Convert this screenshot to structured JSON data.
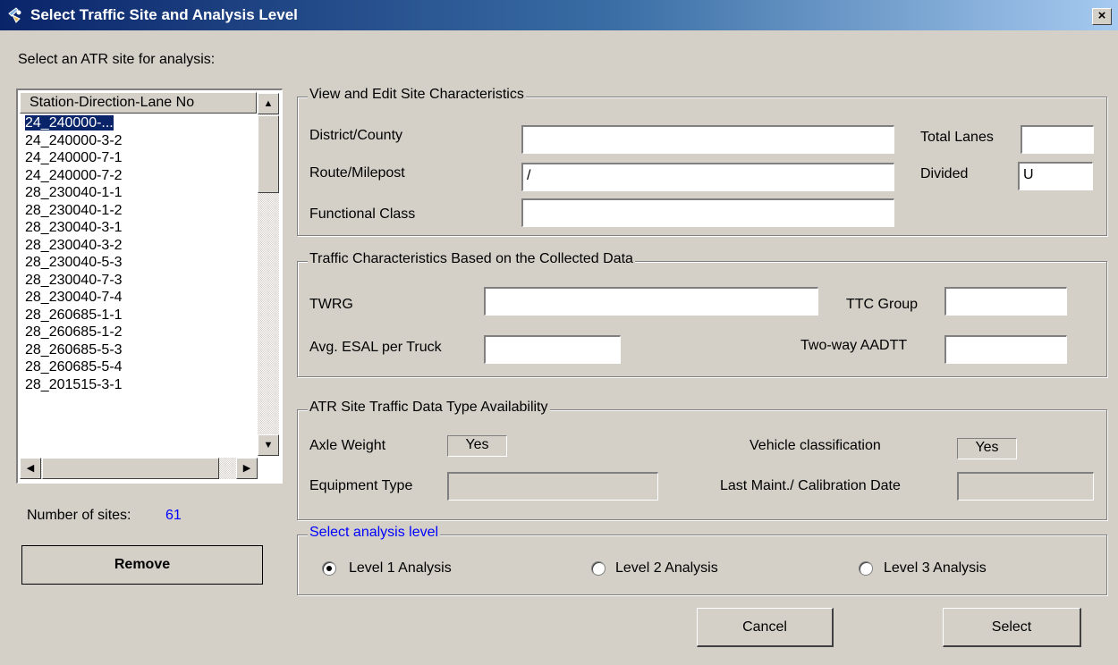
{
  "window": {
    "title": "Select Traffic Site and Analysis Level",
    "close_glyph": "×"
  },
  "site_list": {
    "prompt": "Select an ATR site for analysis:",
    "column_header": "Station-Direction-Lane No",
    "items": [
      "24_240000-...",
      "24_240000-3-2",
      "24_240000-7-1",
      "24_240000-7-2",
      "28_230040-1-1",
      "28_230040-1-2",
      "28_230040-3-1",
      "28_230040-3-2",
      "28_230040-5-3",
      "28_230040-7-3",
      "28_230040-7-4",
      "28_260685-1-1",
      "28_260685-1-2",
      "28_260685-5-3",
      "28_260685-5-4",
      "28_201515-3-1"
    ],
    "selected_index": 0,
    "count_label": "Number of sites:",
    "count_value": "61",
    "remove_label": "Remove"
  },
  "site_characteristics": {
    "title": "View and Edit Site Characteristics",
    "district_label": "District/County",
    "district_value": "",
    "route_label": "Route/Milepost",
    "route_value": "/",
    "functional_label": "Functional Class",
    "functional_value": "",
    "total_lanes_label": "Total Lanes",
    "total_lanes_value": "",
    "divided_label": "Divided",
    "divided_value": "U"
  },
  "traffic_characteristics": {
    "title": "Traffic Characteristics Based on the Collected Data",
    "twrg_label": "TWRG",
    "twrg_value": "",
    "ttc_label": "TTC Group",
    "ttc_value": "",
    "esal_label": "Avg. ESAL per Truck",
    "esal_value": "",
    "aadtt_label": "Two-way AADTT",
    "aadtt_value": ""
  },
  "availability": {
    "title": "ATR Site Traffic Data Type Availability",
    "axle_label": "Axle Weight",
    "axle_value": "Yes",
    "vehicle_label": "Vehicle classification",
    "vehicle_value": "Yes",
    "equipment_label": "Equipment Type",
    "equipment_value": "",
    "maint_label": "Last Maint./ Calibration Date",
    "maint_value": ""
  },
  "analysis_level": {
    "title": "Select analysis level",
    "title_color": "#0000ff",
    "options": [
      "Level 1 Analysis",
      "Level 2 Analysis",
      "Level 3 Analysis"
    ],
    "selected": "Level 1 Analysis"
  },
  "buttons": {
    "cancel": "Cancel",
    "select": "Select"
  },
  "icons": {
    "title_icon": "satellite-dish-icon"
  }
}
